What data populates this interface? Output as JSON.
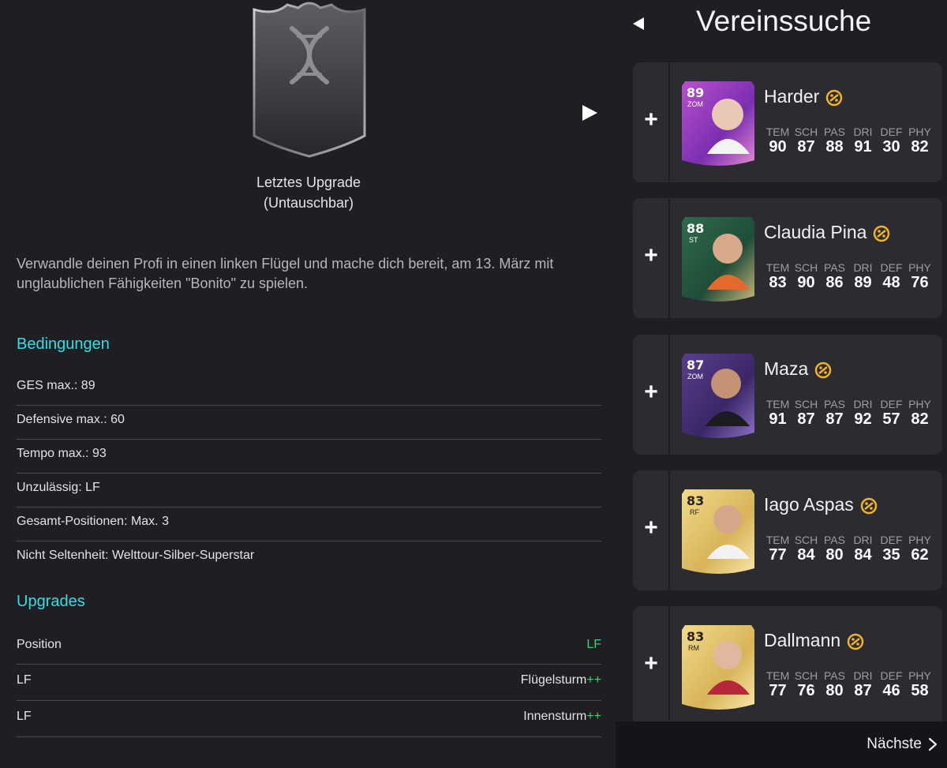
{
  "left": {
    "card_caption_line1": "Letztes Upgrade",
    "card_caption_line2": "(Untauschbar)",
    "description": "Verwandle deinen Profi in einen linken Flügel und mache dich bereit, am 13. März mit unglaublichen Fähigkeiten \"Bonito\" zu spielen.",
    "requirements_heading": "Bedingungen",
    "requirements": [
      "GES max.: 89",
      "Defensive max.: 60",
      "Tempo max.: 93",
      "Unzulässig: LF",
      "Gesamt-Positionen: Max. 3",
      "Nicht Seltenheit: Welttour-Silber-Superstar"
    ],
    "upgrades_heading": "Upgrades",
    "upgrades": [
      {
        "label": "Position",
        "value": "LF",
        "suffix": ""
      },
      {
        "label": "LF",
        "value": "Flügelsturm",
        "suffix": "++"
      },
      {
        "label": "LF",
        "value": "Innensturm",
        "suffix": "++"
      }
    ]
  },
  "right": {
    "title": "Vereinssuche",
    "stat_labels": [
      "TEM",
      "SCH",
      "PAS",
      "DRI",
      "DEF",
      "PHY"
    ],
    "add_symbol": "+",
    "players": [
      {
        "name": "Harder",
        "rating": "89",
        "position": "ZOM",
        "stats": [
          "90",
          "87",
          "88",
          "91",
          "30",
          "82"
        ],
        "card_style": "purple-pink"
      },
      {
        "name": "Claudia Pina",
        "rating": "88",
        "position": "ST",
        "stats": [
          "83",
          "90",
          "86",
          "89",
          "48",
          "76"
        ],
        "card_style": "green"
      },
      {
        "name": "Maza",
        "rating": "87",
        "position": "ZOM",
        "stats": [
          "91",
          "87",
          "87",
          "92",
          "57",
          "82"
        ],
        "card_style": "purple"
      },
      {
        "name": "Iago Aspas",
        "rating": "83",
        "position": "RF",
        "stats": [
          "77",
          "84",
          "80",
          "84",
          "35",
          "62"
        ],
        "card_style": "gold"
      },
      {
        "name": "Dallmann",
        "rating": "83",
        "position": "RM",
        "stats": [
          "77",
          "76",
          "80",
          "87",
          "46",
          "58"
        ],
        "card_style": "gold"
      }
    ],
    "next_label": "Nächste"
  },
  "colors": {
    "background": "#1f1e22",
    "accent_heading": "#2ee0e6",
    "plus_green": "#35d86a",
    "card_bg": "#2c2b31",
    "evo_chip": "#f0b429"
  }
}
